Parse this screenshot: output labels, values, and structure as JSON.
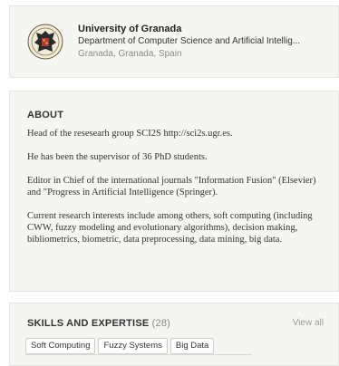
{
  "institution": {
    "name": "University of Granada",
    "department": "Department of Computer Science and Artificial Intellig...",
    "location": "Granada, Granada, Spain",
    "logo_icon": "university-crest-icon"
  },
  "about": {
    "title": "ABOUT",
    "paragraphs": [
      "Head of the resesearh group SCI2S http://sci2s.ugr.es.",
      "He has been the supervisor of 36 PhD students.",
      "Editor in Chief of the international journals \"Information Fusion\" (Elsevier) and \"Progress in Artificial Intelligence (Springer).",
      "Current research interests include among others, soft computing (including CWW, fuzzy modeling and evolutionary algorithms), decision making, bibliometrics, biometric, data preprocessing, data mining, big data."
    ]
  },
  "skills": {
    "title": "SKILLS AND EXPERTISE",
    "count": "(28)",
    "view_all": "View all",
    "tags": [
      "Soft Computing",
      "Fuzzy Systems",
      "Big Data"
    ]
  }
}
